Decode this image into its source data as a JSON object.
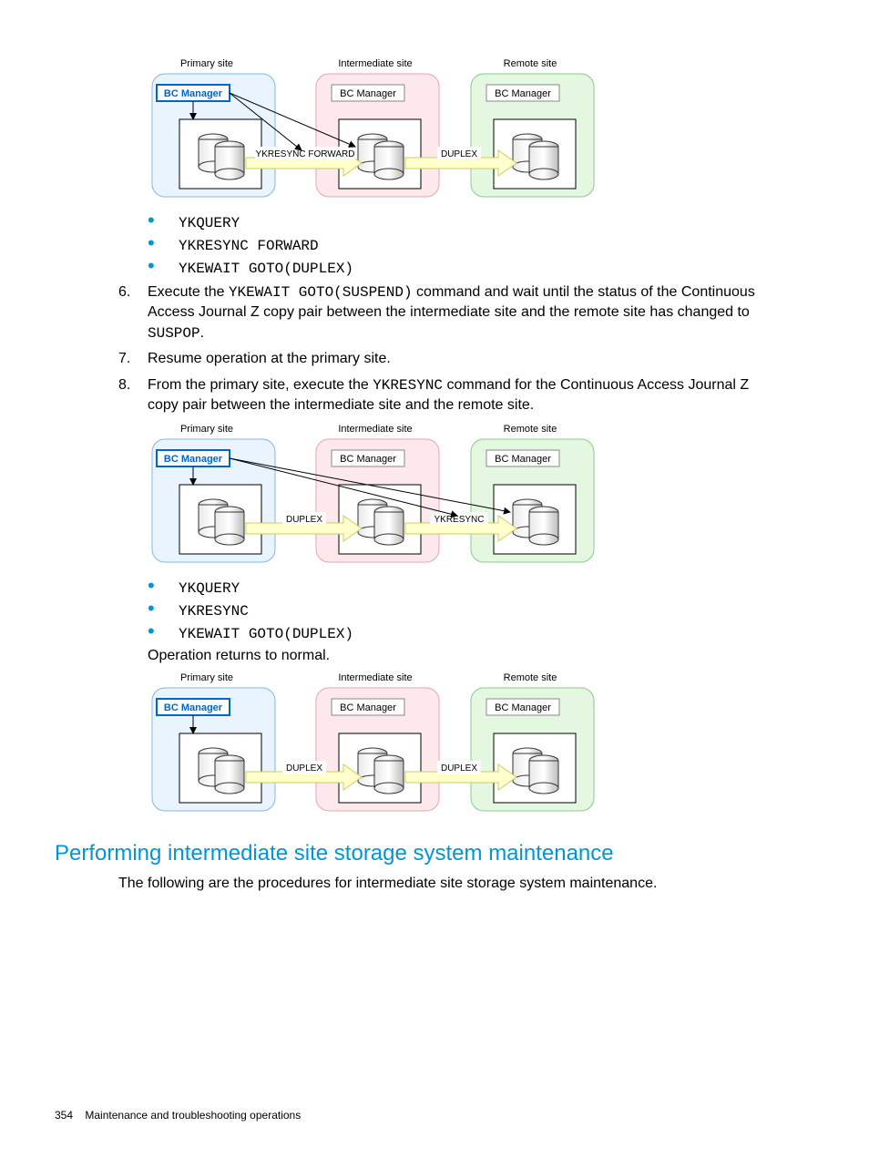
{
  "diagrams": {
    "d1": {
      "primary_label": "Primary site",
      "intermediate_label": "Intermediate site",
      "remote_label": "Remote site",
      "bc_manager": "BC Manager",
      "arrow1_label": "YKRESYNC FORWARD",
      "arrow2_label": "DUPLEX"
    },
    "d2": {
      "primary_label": "Primary site",
      "intermediate_label": "Intermediate site",
      "remote_label": "Remote site",
      "bc_manager": "BC Manager",
      "arrow1_label": "DUPLEX",
      "arrow2_label": "YKRESYNC"
    },
    "d3": {
      "primary_label": "Primary site",
      "intermediate_label": "Intermediate site",
      "remote_label": "Remote site",
      "bc_manager": "BC Manager",
      "arrow1_label": "DUPLEX",
      "arrow2_label": "DUPLEX"
    }
  },
  "bullets": {
    "set1": {
      "b1": "YKQUERY",
      "b2": "YKRESYNC FORWARD",
      "b3": "YKEWAIT GOTO(DUPLEX)"
    },
    "set2": {
      "b1": "YKQUERY",
      "b2": "YKRESYNC",
      "b3": "YKEWAIT GOTO(DUPLEX)"
    }
  },
  "steps": {
    "s6": {
      "num": "6.",
      "pre": "Execute the ",
      "cmd": "YKEWAIT GOTO(SUSPEND)",
      "mid": " command and wait until the status of the Continuous Access Journal Z copy pair between the intermediate site and the remote site has changed to ",
      "state": "SUSPOP",
      "post": "."
    },
    "s7": {
      "num": "7.",
      "text": "Resume operation at the primary site."
    },
    "s8": {
      "num": "8.",
      "pre": "From the primary site, execute the ",
      "cmd": "YKRESYNC",
      "post": " command for the Continuous Access Journal Z copy pair between the intermediate site and the remote site."
    }
  },
  "op_normal": "Operation returns to normal.",
  "heading": "Performing intermediate site storage system maintenance",
  "intro": "The following are the procedures for intermediate site storage system maintenance.",
  "footer": {
    "page": "354",
    "chapter": "Maintenance and troubleshooting operations"
  }
}
